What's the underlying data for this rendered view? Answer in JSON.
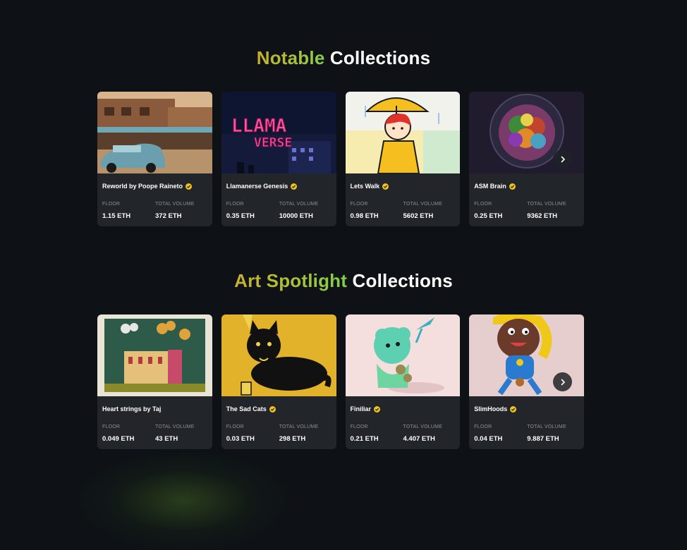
{
  "sections": [
    {
      "title_highlight": "Notable",
      "title_rest": "Collections",
      "cards": [
        {
          "name": "Reworld by Poope Raineto",
          "verified": true,
          "floor_label": "FLOOR",
          "floor": "1.15 ETH",
          "volume_label": "TOTAL VOLUME",
          "volume": "372 ETH"
        },
        {
          "name": "Llamanerse Genesis",
          "verified": true,
          "floor_label": "FLOOR",
          "floor": "0.35 ETH",
          "volume_label": "TOTAL VOLUME",
          "volume": "10000 ETH"
        },
        {
          "name": "Lets Walk",
          "verified": true,
          "floor_label": "FLOOR",
          "floor": "0.98 ETH",
          "volume_label": "TOTAL VOLUME",
          "volume": "5602 ETH"
        },
        {
          "name": "ASM Brain",
          "verified": true,
          "floor_label": "FLOOR",
          "floor": "0.25 ETH",
          "volume_label": "TOTAL VOLUME",
          "volume": "9362 ETH"
        }
      ]
    },
    {
      "title_highlight": "Art Spotlight",
      "title_rest": "Collections",
      "cards": [
        {
          "name": "Heart strings by Taj",
          "verified": false,
          "floor_label": "FLOOR",
          "floor": "0.049 ETH",
          "volume_label": "TOTAL VOLUME",
          "volume": "43 ETH"
        },
        {
          "name": "The Sad Cats",
          "verified": true,
          "floor_label": "FLOOR",
          "floor": "0.03 ETH",
          "volume_label": "TOTAL VOLUME",
          "volume": "298 ETH"
        },
        {
          "name": "Finiliar",
          "verified": true,
          "floor_label": "FLOOR",
          "floor": "0.21 ETH",
          "volume_label": "TOTAL VOLUME",
          "volume": "4.407 ETH"
        },
        {
          "name": "SlimHoods",
          "verified": true,
          "floor_label": "FLOOR",
          "floor": "0.04 ETH",
          "volume_label": "TOTAL VOLUME",
          "volume": "9.887 ETH"
        }
      ]
    }
  ],
  "icons": {
    "verified": "verified-badge-icon",
    "next": "chevron-right-icon"
  },
  "colors": {
    "background": "#0e1216",
    "card": "#22262b",
    "accent_start": "#c8b02a",
    "accent_end": "#7fcf4a",
    "verified": "#f0c419",
    "label": "#8b9096"
  }
}
